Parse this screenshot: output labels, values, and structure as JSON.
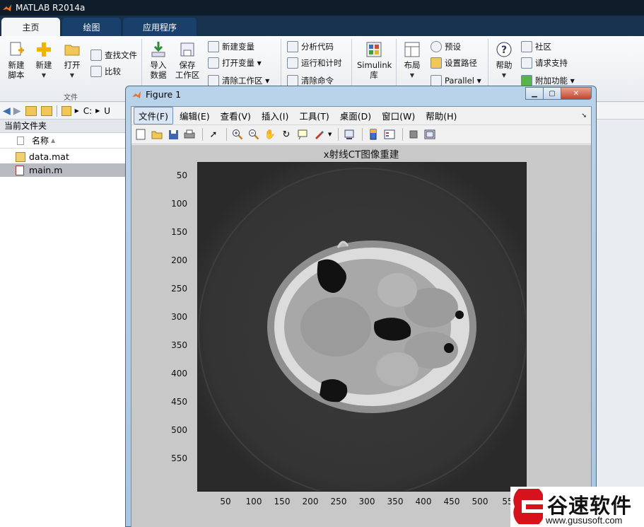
{
  "app": {
    "title": "MATLAB R2014a"
  },
  "tabs": [
    {
      "label": "主页"
    },
    {
      "label": "绘图"
    },
    {
      "label": "应用程序"
    }
  ],
  "ribbon": {
    "new_script": "新建\n脚本",
    "new": "新建",
    "open": "打开",
    "find_files": "查找文件",
    "compare": "比较",
    "file_group": "文件",
    "import_data": "导入\n数据",
    "save_workspace": "保存\n工作区",
    "new_variable": "新建变量",
    "open_variable": "打开变量",
    "clear_workspace": "清除工作区",
    "analyze_code": "分析代码",
    "run_and_time": "运行和计时",
    "clear_commands": "清除命令",
    "simulink": "Simulink\n库",
    "layout": "布局",
    "preferences": "预设",
    "set_path": "设置路径",
    "parallel": "Parallel",
    "help": "帮助",
    "community": "社区",
    "request_support": "请求支持",
    "addons": "附加功能"
  },
  "address": {
    "drive": "C:",
    "next": "U"
  },
  "current_folder": {
    "title": "当前文件夹",
    "column_name": "名称",
    "files": [
      {
        "name": "data.mat"
      },
      {
        "name": "main.m"
      }
    ]
  },
  "figure": {
    "title": "Figure 1",
    "menus": [
      "文件(F)",
      "编辑(E)",
      "查看(V)",
      "插入(I)",
      "工具(T)",
      "桌面(D)",
      "窗口(W)",
      "帮助(H)"
    ],
    "plot_title": "x射线CT图像重建",
    "y_ticks": [
      "50",
      "100",
      "150",
      "200",
      "250",
      "300",
      "350",
      "400",
      "450",
      "500",
      "550"
    ],
    "x_ticks": [
      "50",
      "100",
      "150",
      "200",
      "250",
      "300",
      "350",
      "400",
      "450",
      "500",
      "55"
    ]
  },
  "watermark": {
    "name": "谷速软件",
    "url": "www.gususoft.com"
  }
}
